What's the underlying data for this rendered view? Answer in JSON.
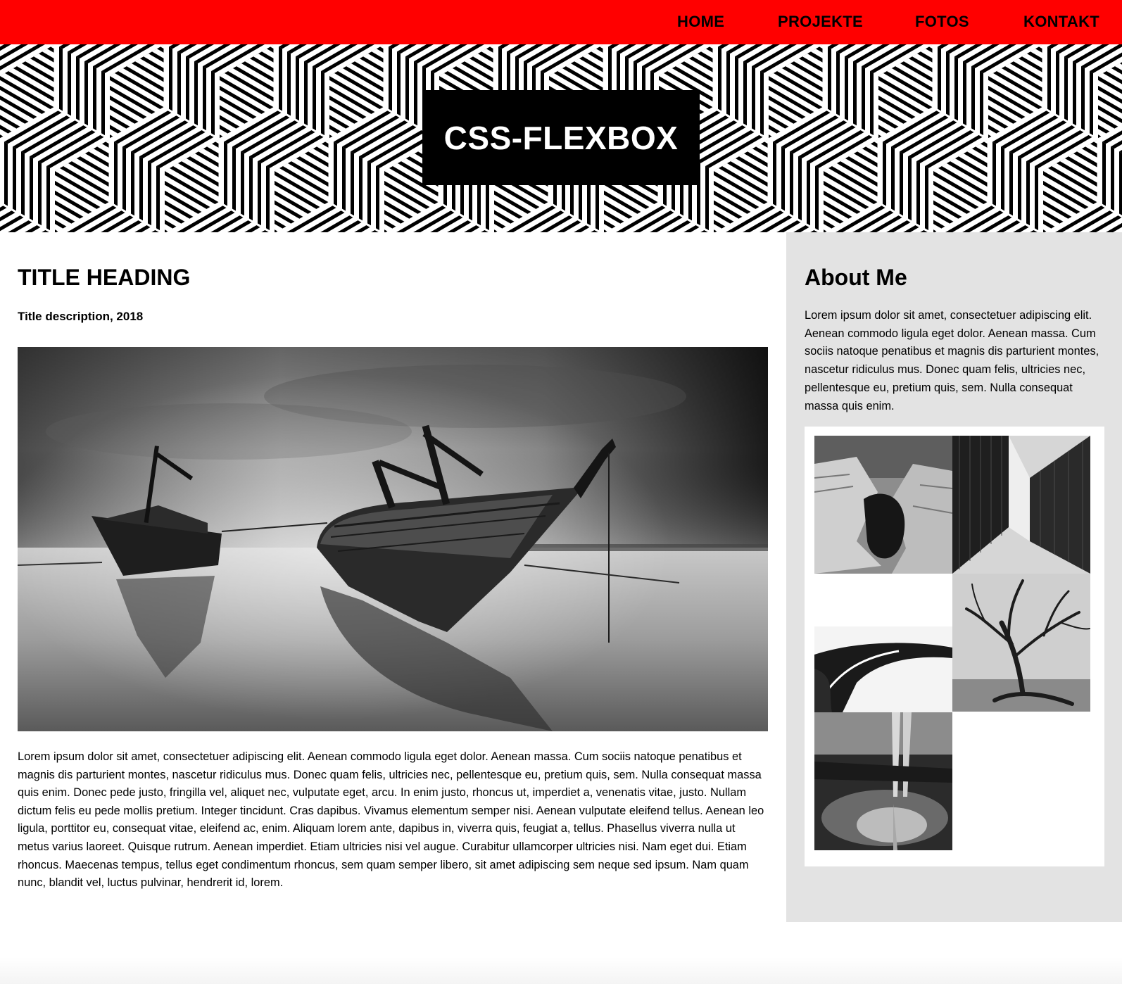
{
  "nav": {
    "items": [
      {
        "label": "HOME"
      },
      {
        "label": "PROJEKTE"
      },
      {
        "label": "FOTOS"
      },
      {
        "label": "KONTAKT"
      }
    ]
  },
  "hero": {
    "title": "CSS-FLEXBOX"
  },
  "main": {
    "heading": "TITLE HEADING",
    "description": "Title description, 2018",
    "body": "Lorem ipsum dolor sit amet, consectetuer adipiscing elit. Aenean commodo ligula eget dolor. Aenean massa. Cum sociis natoque penatibus et magnis dis parturient montes, nascetur ridiculus mus. Donec quam felis, ultricies nec, pellentesque eu, pretium quis, sem. Nulla consequat massa quis enim. Donec pede justo, fringilla vel, aliquet nec, vulputate eget, arcu. In enim justo, rhoncus ut, imperdiet a, venenatis vitae, justo. Nullam dictum felis eu pede mollis pretium. Integer tincidunt. Cras dapibus. Vivamus elementum semper nisi. Aenean vulputate eleifend tellus. Aenean leo ligula, porttitor eu, consequat vitae, eleifend ac, enim. Aliquam lorem ante, dapibus in, viverra quis, feugiat a, tellus. Phasellus viverra nulla ut metus varius laoreet. Quisque rutrum. Aenean imperdiet. Etiam ultricies nisi vel augue. Curabitur ullamcorper ultricies nisi. Nam eget dui. Etiam rhoncus. Maecenas tempus, tellus eget condimentum rhoncus, sem quam semper libero, sit amet adipiscing sem neque sed ipsum. Nam quam nunc, blandit vel, luctus pulvinar, hendrerit id, lorem."
  },
  "sidebar": {
    "heading": "About Me",
    "text": "Lorem ipsum dolor sit amet, consectetuer adipiscing elit. Aenean commodo ligula eget dolor. Aenean massa. Cum sociis natoque penatibus et magnis dis parturient montes, nascetur ridiculus mus. Donec quam felis, ultricies nec, pellentesque eu, pretium quis, sem. Nulla consequat massa quis enim."
  },
  "colors": {
    "nav_bg": "#ff0000",
    "sidebar_bg": "#e3e3e3",
    "title_box_bg": "#000000"
  }
}
